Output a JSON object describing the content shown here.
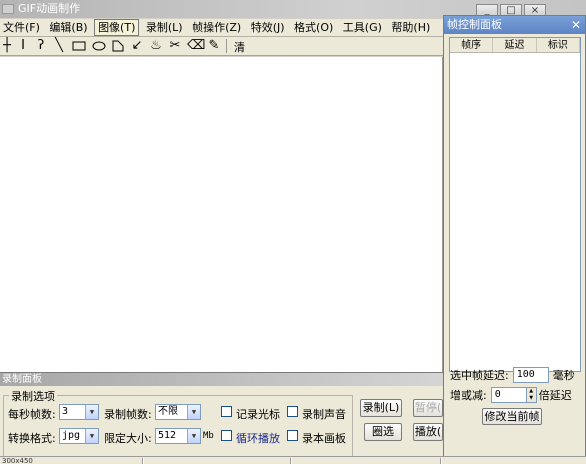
{
  "window": {
    "title": "GIF动画制作"
  },
  "menu": {
    "items": [
      "文件(F)",
      "编辑(B)",
      "图像(T)",
      "录制(L)",
      "帧操作(Z)",
      "特效(J)",
      "格式(O)",
      "工具(G)",
      "帮助(H)"
    ],
    "active_index": 2
  },
  "toolbar": {
    "icons": [
      "crosshair-icon",
      "text-cursor-icon",
      "lasso-icon",
      "line-icon",
      "rectangle-icon",
      "ellipse-icon",
      "shape-icon",
      "arrow-icon",
      "spray-icon",
      "scissors-icon",
      "eraser-icon",
      "eyedropper-icon"
    ],
    "clear_label": "清"
  },
  "frame_panel": {
    "title": "帧控制面板",
    "columns": [
      "帧序",
      "延迟",
      "标识"
    ],
    "delay_label": "选中帧延迟:",
    "delay_value": "100",
    "delay_unit": "毫秒",
    "adjust_label": "增或减:",
    "adjust_value": "0",
    "adjust_unit": "倍延迟",
    "apply_button": "修改当前帧"
  },
  "record_panel": {
    "title": "录制面板",
    "group_label": "录制选项",
    "fps_label": "每秒帧数:",
    "fps_value": "3",
    "frames_label": "录制帧数:",
    "frames_value": "不限",
    "format_label": "转换格式:",
    "format_value": "jpg",
    "size_label": "限定大小:",
    "size_value": "512",
    "size_unit": "Mb",
    "checkboxes": [
      "记录光标",
      "录制声音",
      "循环播放",
      "录本画板"
    ],
    "buttons": {
      "record": "录制(L)",
      "pause": "暂停(",
      "select": "圈选",
      "play": "播放("
    }
  },
  "status": {
    "text": "300x450"
  },
  "colors": {
    "loop_label": "#1a2a8a"
  }
}
